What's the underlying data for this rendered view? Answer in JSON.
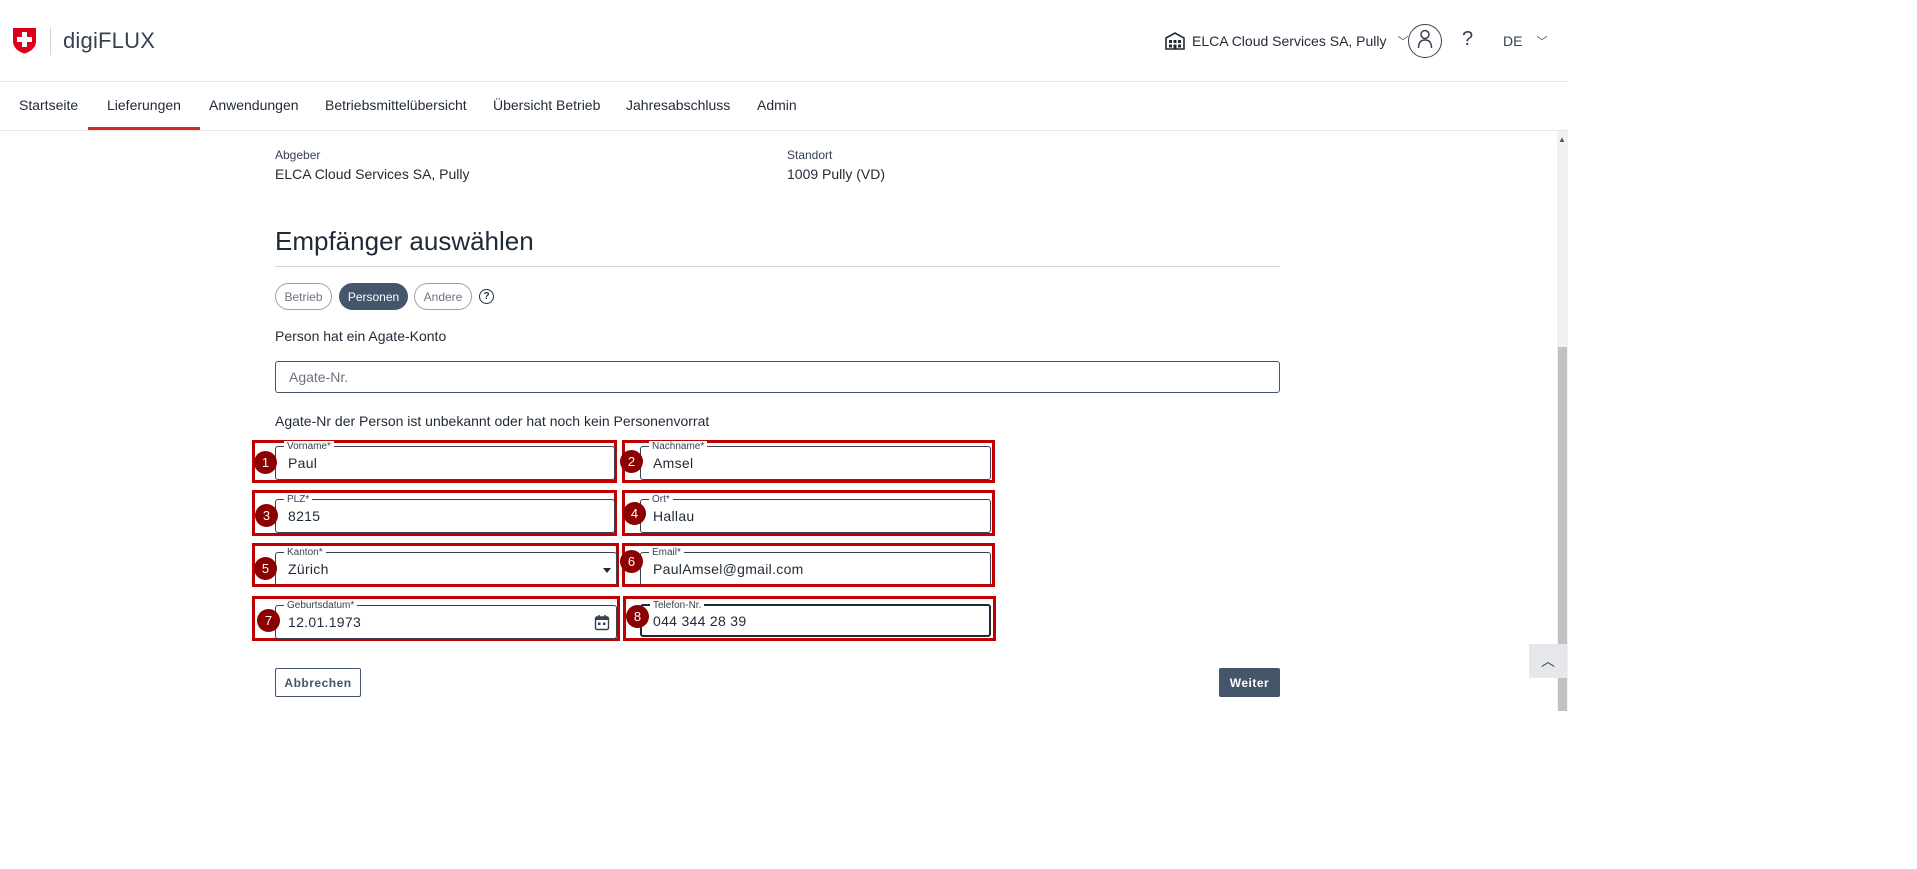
{
  "header": {
    "app_title": "digiFLUX",
    "organization": "ELCA Cloud Services SA, Pully",
    "help": "?",
    "language": "DE",
    "icons": {
      "logo": "swiss-cross-logo",
      "org": "building-icon",
      "user": "user-icon",
      "chevron": "chevron-down-icon"
    }
  },
  "nav": {
    "items": [
      {
        "label": "Startseite"
      },
      {
        "label": "Lieferungen",
        "active": true
      },
      {
        "label": "Anwendungen"
      },
      {
        "label": "Betriebsmittelübersicht"
      },
      {
        "label": "Übersicht Betrieb"
      },
      {
        "label": "Jahresabschluss"
      },
      {
        "label": "Admin"
      }
    ]
  },
  "delivery": {
    "abgeber_label": "Abgeber",
    "abgeber_value": "ELCA Cloud Services SA, Pully",
    "standort_label": "Standort",
    "standort_value": "1009 Pully (VD)"
  },
  "recipient": {
    "title": "Empfänger auswählen",
    "chips": [
      {
        "label": "Betrieb",
        "active": false
      },
      {
        "label": "Personen",
        "active": true
      },
      {
        "label": "Andere",
        "active": false
      }
    ],
    "chip_help": "?",
    "agate_account_text": "Person hat ein Agate-Konto",
    "agate_placeholder": "Agate-Nr.",
    "unknown_text": "Agate-Nr der Person ist unbekannt oder hat noch kein Personenvorrat",
    "fields": {
      "vorname": {
        "label": "Vorname*",
        "value": "Paul"
      },
      "nachname": {
        "label": "Nachname*",
        "value": "Amsel"
      },
      "plz": {
        "label": "PLZ*",
        "value": "8215"
      },
      "ort": {
        "label": "Ort*",
        "value": "Hallau"
      },
      "kanton": {
        "label": "Kanton*",
        "value": "Zürich"
      },
      "email": {
        "label": "Email*",
        "value": "PaulAmsel@gmail.com"
      },
      "geburtsdatum": {
        "label": "Geburtsdatum*",
        "value": "12.01.1973"
      },
      "telefon": {
        "label": "Telefon-Nr.",
        "value": "044 344 28 39"
      }
    },
    "annotations": [
      "1",
      "2",
      "3",
      "4",
      "5",
      "6",
      "7",
      "8"
    ]
  },
  "actions": {
    "cancel": "Abbrechen",
    "next": "Weiter"
  },
  "colors": {
    "accent_red": "#dc2626",
    "annotation_red": "#c00000",
    "badge_red": "#8b0000",
    "primary": "#45566b"
  }
}
